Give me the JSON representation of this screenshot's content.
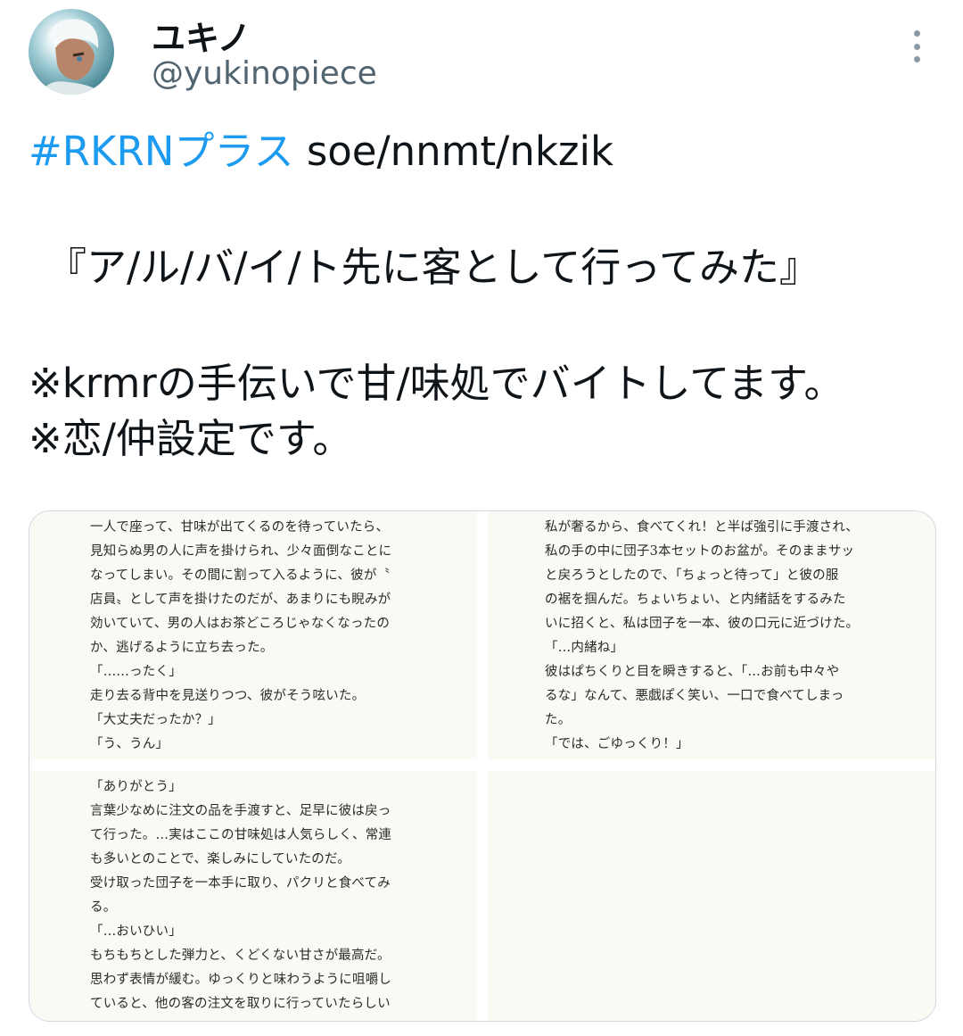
{
  "author": {
    "display_name": "ユキノ",
    "handle": "@yukinopiece",
    "avatar_icon": "anime-character-avatar"
  },
  "more_icon": "more-vertical-icon",
  "tweet": {
    "hashtag": "#RKRNプラス",
    "pairing": " soe/nnmt/nkzik",
    "title": "『ア/ル/バ/イ/ト先に客として行ってみた』",
    "note1": "※krmrの手伝いで甘/味処でバイトしてます。",
    "note2": "※恋/仲設定です。"
  },
  "media": {
    "panel1": [
      "一人で座って、甘味が出てくるのを待っていたら、",
      "見知らぬ男の人に声を掛けられ、少々面倒なことに",
      "なってしまい。その間に割って入るように、彼が〝",
      "店員〟として声を掛けたのだが、あまりにも睨みが",
      "効いていて、男の人はお茶どころじゃなくなったの",
      "か、逃げるように立ち去った。",
      "「……ったく」",
      "走り去る背中を見送りつつ、彼がそう呟いた。",
      "「大丈夫だったか？」",
      "「う、うん」"
    ],
    "panel2": [
      "私が奢るから、食べてくれ！と半ば強引に手渡され、",
      "私の手の中に団子3本セットのお盆が。そのままサッ",
      "と戻ろうとしたので、「ちょっと待って」と彼の服",
      "の裾を掴んだ。ちょいちょい、と内緒話をするみた",
      "いに招くと、私は団子を一本、彼の口元に近づけた。",
      "「…内緒ね」",
      "彼はぱちくりと目を瞬きすると、「…お前も中々や",
      "るな」なんて、悪戯ぽく笑い、一口で食べてしまっ",
      "た。",
      "「では、ごゆっくり！」"
    ],
    "panel3": [
      "「ありがとう」",
      "言葉少なめに注文の品を手渡すと、足早に彼は戻っ",
      "て行った。…実はここの甘味処は人気らしく、常連",
      "も多いとのことで、楽しみにしていたのだ。",
      "受け取った団子を一本手に取り、パクリと食べてみ",
      "る。",
      "「…おいひい」",
      "もちもちとした弾力と、くどくない甘さが最高だ。",
      "思わず表情が緩む。ゆっくりと味わうように咀嚼し",
      "ていると、他の客の注文を取りに行っていたらしい"
    ]
  }
}
